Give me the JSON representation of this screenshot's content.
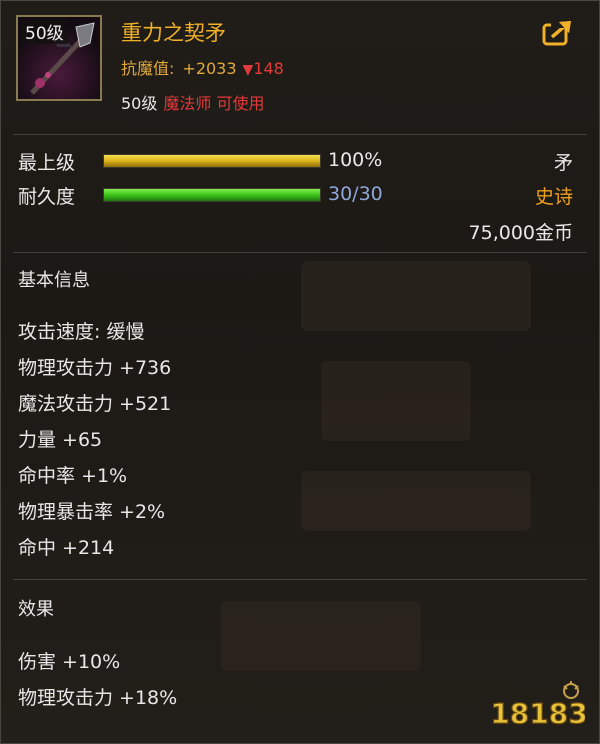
{
  "item": {
    "level_badge": "50级",
    "name": "重力之契矛",
    "resist_label": "抗魔值:",
    "resist_plus": "+2033",
    "resist_minus": "148",
    "req_level": "50级",
    "req_class": "魔法师 可使用"
  },
  "bars": {
    "grade_label": "最上级",
    "grade_value": "100%",
    "grade_fill": 1.0,
    "durability_label": "耐久度",
    "durability_value": "30/30",
    "durability_fill": 1.0
  },
  "info": {
    "type": "矛",
    "rarity": "史诗",
    "price": "75,000金币"
  },
  "basic": {
    "title": "基本信息",
    "stats": [
      "攻击速度: 缓慢",
      "物理攻击力 +736",
      "魔法攻击力 +521",
      "力量 +65",
      "命中率 +1%",
      "物理暴击率 +2%",
      "命中 +214"
    ]
  },
  "effects": {
    "title": "效果",
    "stats": [
      "伤害 +10%",
      "物理攻击力 +18%"
    ]
  },
  "watermark": {
    "text": "18183"
  },
  "icons": {
    "share": "share-icon",
    "down": "down-triangle-icon",
    "item": "spear-icon"
  },
  "colors": {
    "name": "#f0b027",
    "rarity": "#f0a020",
    "negative": "#e23a3a",
    "durability_text": "#8fa7d8"
  }
}
